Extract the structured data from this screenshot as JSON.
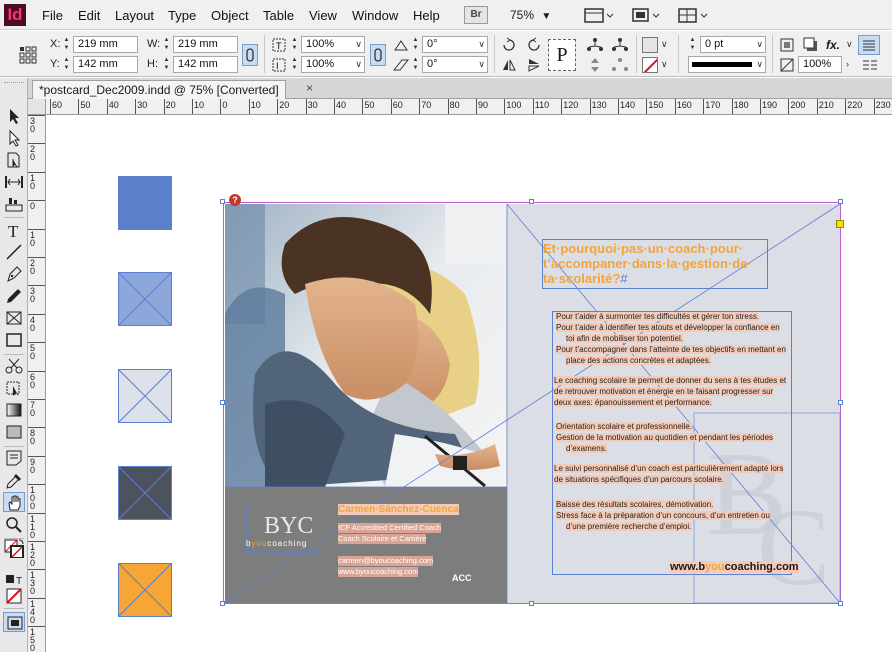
{
  "app": {
    "logo": "Id",
    "menus": [
      "File",
      "Edit",
      "Layout",
      "Type",
      "Object",
      "Table",
      "View",
      "Window",
      "Help"
    ],
    "bridge_label": "Br",
    "zoom": "75%"
  },
  "control_panel": {
    "x_label": "X:",
    "x_value": "219 mm",
    "y_label": "Y:",
    "y_value": "142 mm",
    "w_label": "W:",
    "w_value": "219 mm",
    "h_label": "H:",
    "h_value": "142 mm",
    "scale_x": "100%",
    "scale_y": "100%",
    "rotate": "0°",
    "shear": "0°",
    "stroke_weight": "0 pt",
    "opacity": "100%",
    "p_glyph": "P",
    "fx_label": "fx."
  },
  "document": {
    "tab_title": "*postcard_Dec2009.indd @ 75% [Converted]",
    "tab_close": "×"
  },
  "rulers": {
    "horizontal": [
      "60",
      "50",
      "40",
      "30",
      "20",
      "10",
      "0",
      "10",
      "20",
      "30",
      "40",
      "50",
      "60",
      "70",
      "80",
      "90",
      "100",
      "110",
      "120",
      "130",
      "140",
      "150",
      "160",
      "170",
      "180",
      "190",
      "200",
      "210",
      "220",
      "230"
    ],
    "vertical": [
      "30",
      "20",
      "10",
      "0",
      "10",
      "20",
      "30",
      "40",
      "50",
      "60",
      "70",
      "80",
      "90",
      "100",
      "110",
      "120",
      "130",
      "140",
      "150"
    ]
  },
  "postcard": {
    "headline_1": "Et·pourquoi·pas·un·coach·pour·",
    "headline_2": "t’accompaner·dans·la·gestion·de·",
    "headline_3": "ta·scolarité?",
    "pilcrow": "#",
    "bullets_1": [
      "Pour t’aider à surmonter tes difficultés et gérer ton stress.",
      "Pour t’aider à identifier tes atouts et développer la confiance en toi afin de mobiliser ton potentiel.",
      "Pour t’accompagner dans l’atteinte de tes objectifs en mettant en place des actions concrètes et adaptées."
    ],
    "para_1": "Le coaching scolaire te permet de donner du sens à tes études et de retrouver motivation et énergie en te faisant progresser sur deux axes: épanouissement et performance.",
    "bullets_2": [
      "Orientation scolaire et professionnelle.",
      "Gestion de la motivation au quotidien et pendant les périodes d’examens."
    ],
    "para_2": "Le suivi personnalisé d’un coach est particulièrement adapté lors de situations spécifiques d’un parcours scolaire.",
    "bullets_3": [
      "Baisse des résultats scolaires, démotivation.",
      "Stress face à la préparation d’un concours, d’un entretien ou d’une première recherche d’emploi."
    ],
    "url_pre": "www.b",
    "url_you": "you",
    "url_post": "coaching.com",
    "card_name": "Carmen·Sánchez-Cuenca",
    "card_line_1": "ICF Accredited Certified Coach",
    "card_line_2": "Coach Scolaire et Carrière",
    "card_email": "carmen@byoucoaching.com",
    "card_web": "www.byoucoaching.com",
    "logo_letters": "BYC",
    "logo_tag_b": "b",
    "logo_tag_you": "you",
    "logo_tag_rest": "coaching",
    "acc_label": "ACC",
    "warn_glyph": "?"
  },
  "colors": {
    "accent_orange": "#f3a43b",
    "frame_blue": "#5b7fd1",
    "margin_violet": "#c05ad1",
    "highlight_salmon": "#f3cbb8",
    "swatches": [
      "#5b7fc8",
      "#8ea7db",
      "#dde1ea",
      "#4d535e",
      "#f7a534"
    ]
  }
}
